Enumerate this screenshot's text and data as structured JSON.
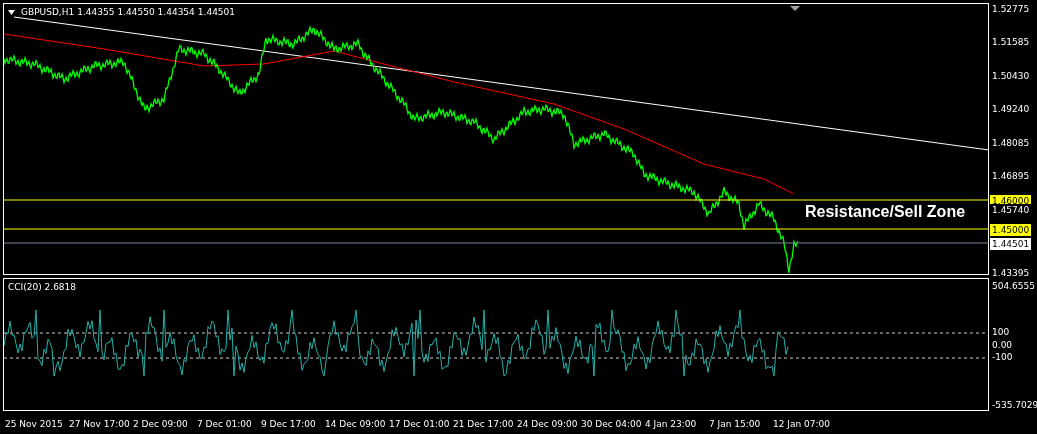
{
  "chart_header": {
    "symbol": "GBPUSD,H1",
    "prices": [
      "1.44355",
      "1.44550",
      "1.44354",
      "1.44501"
    ]
  },
  "price_axis": {
    "ticks": [
      "1.52775",
      "1.51585",
      "1.50430",
      "1.49240",
      "1.48085",
      "1.46895",
      "1.43395"
    ],
    "level_labels": [
      {
        "label": "1.46000",
        "kind": "line"
      },
      {
        "label": "1.45740",
        "kind": "tick"
      },
      {
        "label": "1.45000",
        "kind": "line"
      },
      {
        "label": "1.44501",
        "kind": "bid"
      }
    ]
  },
  "annotation": "Resistance/Sell Zone",
  "indicator": {
    "title": "CCI(20) 2.6818",
    "ticks": [
      "504.6555",
      "100",
      "0.00",
      "-100",
      "-535.7029"
    ]
  },
  "time_axis": [
    "25 Nov 2015",
    "27 Nov 17:00",
    "2 Dec 09:00",
    "7 Dec 01:00",
    "9 Dec 17:00",
    "14 Dec 09:00",
    "17 Dec 01:00",
    "21 Dec 17:00",
    "24 Dec 09:00",
    "30 Dec 04:00",
    "4 Jan 23:00",
    "7 Jan 15:00",
    "12 Jan 07:00"
  ]
}
